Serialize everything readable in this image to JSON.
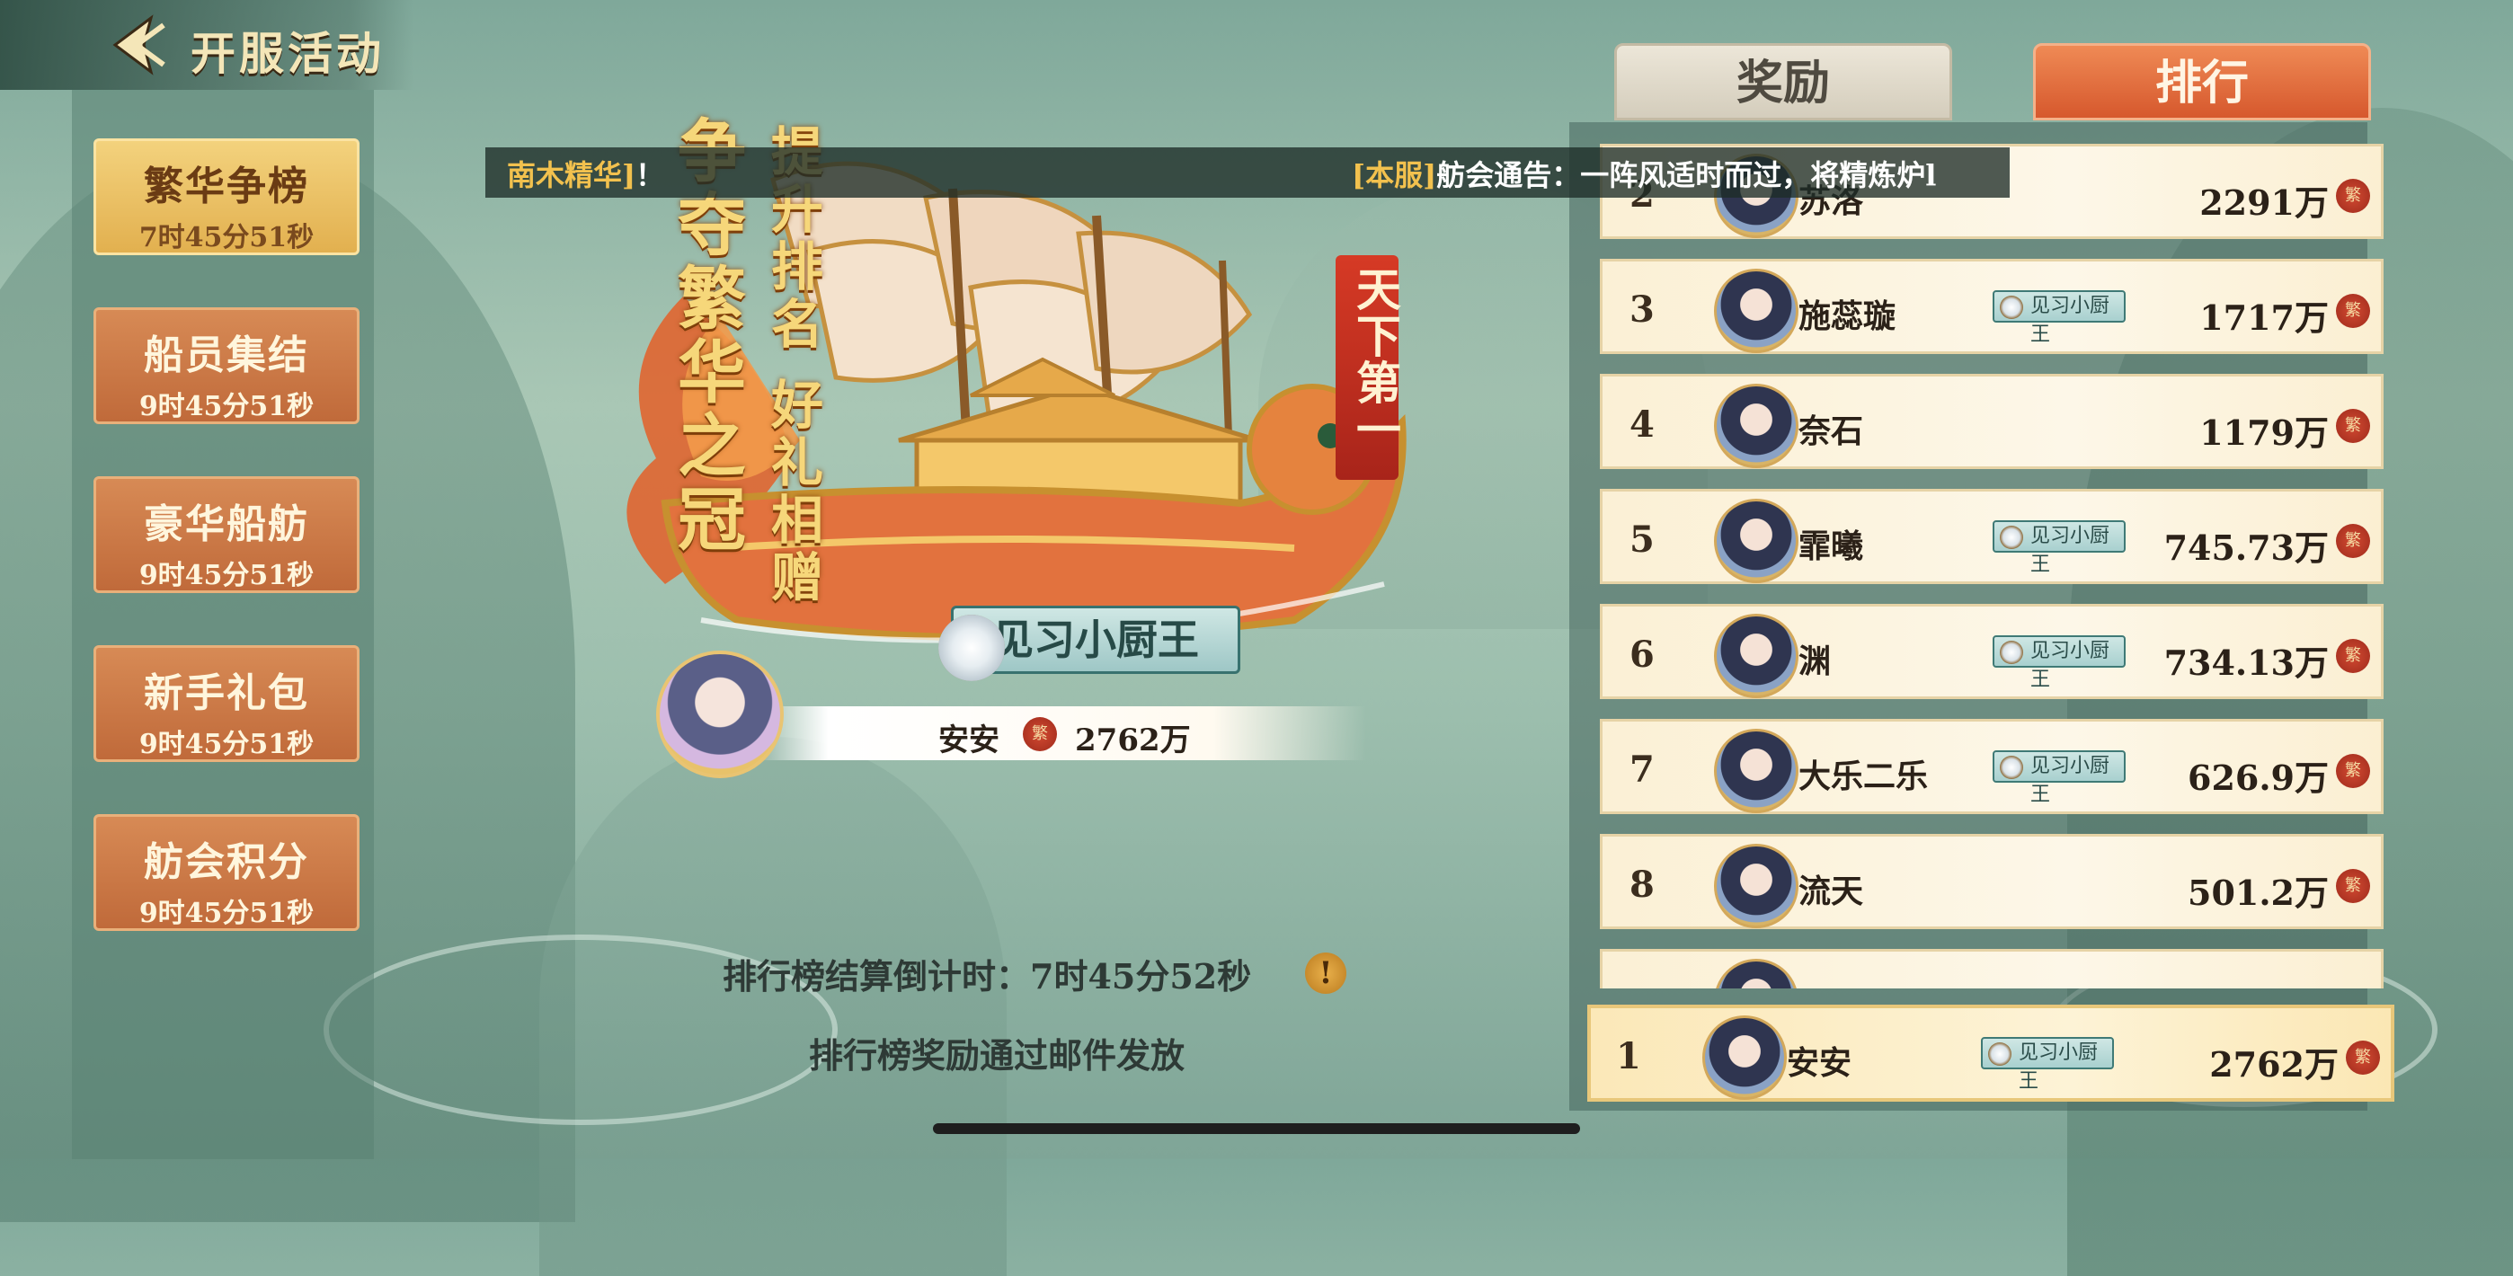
{
  "header": {
    "title": "开服活动"
  },
  "sidebar": {
    "items": [
      {
        "label": "繁华争榜",
        "time": "7时45分51秒",
        "active": true
      },
      {
        "label": "船员集结",
        "time": "9时45分51秒"
      },
      {
        "label": "豪华船舫",
        "time": "9时45分51秒"
      },
      {
        "label": "新手礼包",
        "time": "9时45分51秒"
      },
      {
        "label": "舫会积分",
        "time": "9时45分51秒"
      }
    ]
  },
  "banner": {
    "slogan1": "争夺繁华之冠",
    "slogan2": "提升排名 好礼相赠",
    "red_banner": "天下第一",
    "chef_title": "见习小厨王",
    "winner": {
      "name": "安安",
      "score": "2762万"
    },
    "coin_glyph": "繁"
  },
  "marquee": {
    "left_text": "南木精华]",
    "left_suffix": "！",
    "right_tag": "[本服]",
    "right_text": "舫会通告：一阵风适时而过，将精炼炉l"
  },
  "tabs": {
    "reward": "奖励",
    "rank": "排行"
  },
  "ranking": {
    "rows": [
      {
        "rank": "2",
        "name": "苏洛",
        "title": "",
        "score": "2291万"
      },
      {
        "rank": "3",
        "name": "施蕊璇",
        "title": "见习小厨王",
        "score": "1717万"
      },
      {
        "rank": "4",
        "name": "奈石",
        "title": "",
        "score": "1179万"
      },
      {
        "rank": "5",
        "name": "霏曦",
        "title": "见习小厨王",
        "score": "745.73万"
      },
      {
        "rank": "6",
        "name": "渊",
        "title": "见习小厨王",
        "score": "734.13万"
      },
      {
        "rank": "7",
        "name": "大乐二乐",
        "title": "见习小厨王",
        "score": "626.9万"
      },
      {
        "rank": "8",
        "name": "流天",
        "title": "",
        "score": "501.2万"
      }
    ],
    "mine": {
      "rank": "1",
      "name": "安安",
      "title": "见习小厨王",
      "score": "2762万"
    }
  },
  "footer": {
    "countdown": "排行榜结算倒计时：7时45分52秒",
    "warn_icon": "!",
    "mail_note": "排行榜奖励通过邮件发放"
  },
  "icons": [
    "back-arrow-icon",
    "chef-pot-icon",
    "coin-icon",
    "exclamation-icon",
    "avatar"
  ],
  "colors": {
    "accent_orange": "#d6582d",
    "gold": "#f6d77a",
    "panel_cream": "#fdf7e8"
  }
}
